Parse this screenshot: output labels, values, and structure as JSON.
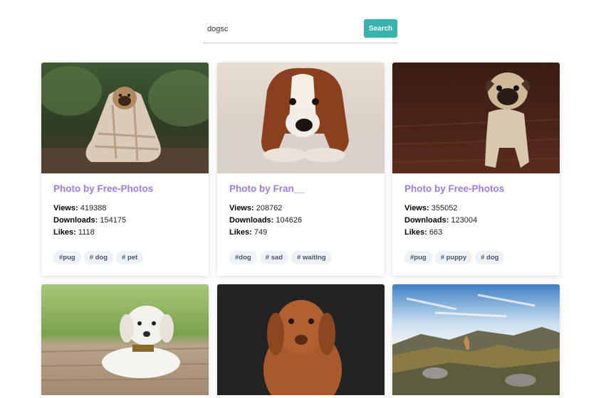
{
  "search": {
    "value": "dogsc",
    "button_label": "Search"
  },
  "cards": [
    {
      "photo": "pug-in-blanket",
      "title": "Photo by Free-Photos",
      "views_label": "Views:",
      "views": "419388",
      "downloads_label": "Downloads:",
      "downloads": "154175",
      "likes_label": "Likes:",
      "likes": "1118",
      "tags": [
        "#pug",
        "# dog",
        "# pet"
      ]
    },
    {
      "photo": "spaniel-lying-on-rug",
      "title": "Photo by Fran__",
      "views_label": "Views:",
      "views": "208762",
      "downloads_label": "Downloads:",
      "downloads": "104626",
      "likes_label": "Likes:",
      "likes": "749",
      "tags": [
        "#dog",
        "# sad",
        "# waiting"
      ]
    },
    {
      "photo": "pug-on-wood-floor",
      "title": "Photo by Free-Photos",
      "views_label": "Views:",
      "views": "355052",
      "downloads_label": "Downloads:",
      "downloads": "123004",
      "likes_label": "Likes:",
      "likes": "663",
      "tags": [
        "#pug",
        "# puppy",
        "# dog"
      ]
    },
    {
      "photo": "white-puppy-on-deck"
    },
    {
      "photo": "brown-vizsla-dark-background"
    },
    {
      "photo": "dog-on-mountain-landscape"
    }
  ],
  "colors": {
    "accent": "#38b2ac",
    "title": "#9f7aea",
    "tag_bg": "#edf2f7"
  }
}
